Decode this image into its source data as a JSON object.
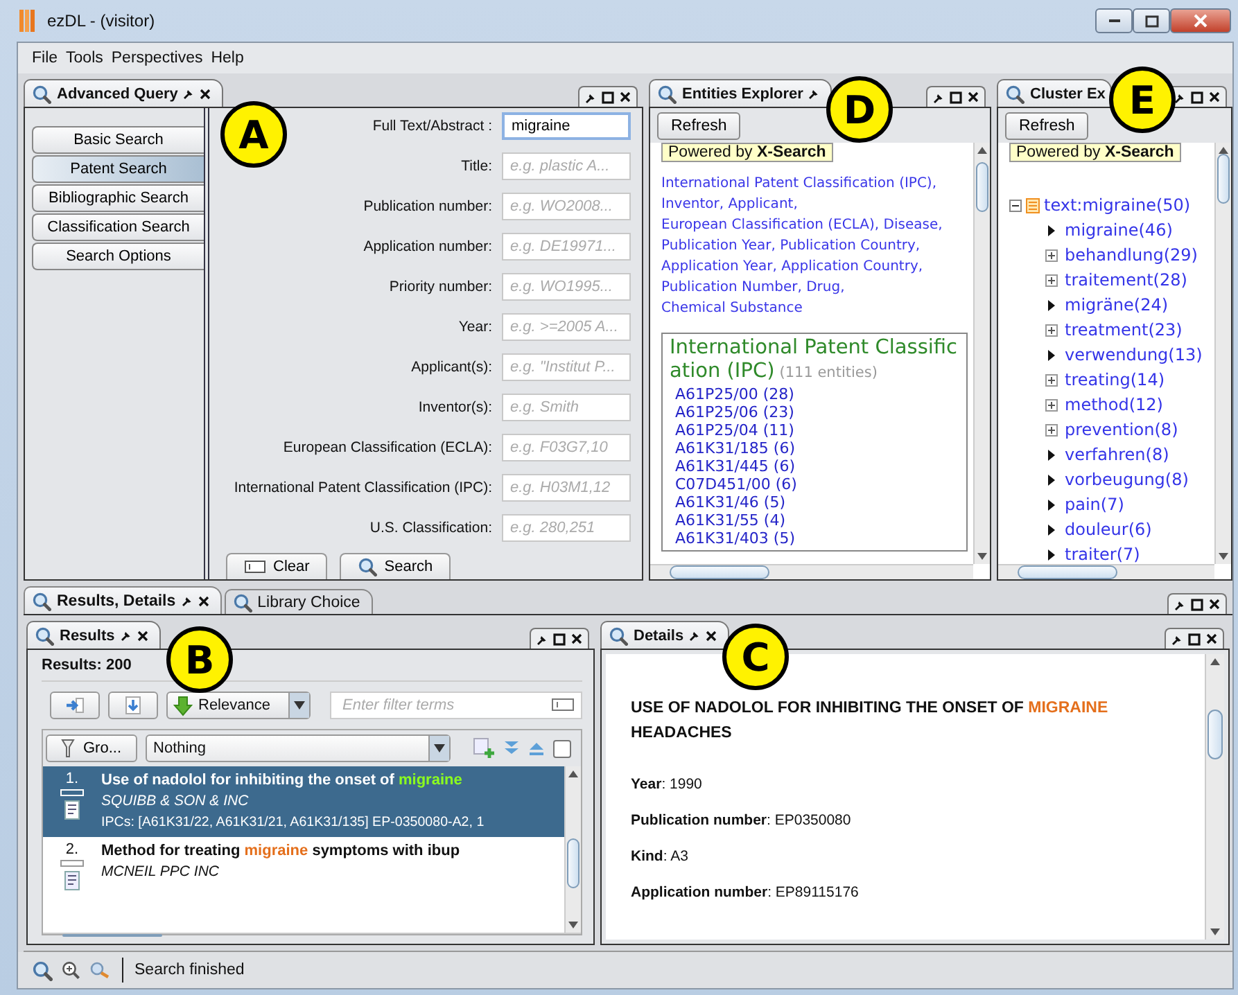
{
  "window": {
    "title": "ezDL - (visitor)"
  },
  "menu": [
    "File",
    "Tools",
    "Perspectives",
    "Help"
  ],
  "advanced_query": {
    "tab": "Advanced Query",
    "modes": [
      {
        "label": "Basic Search",
        "selected": false
      },
      {
        "label": "Patent Search",
        "selected": true
      },
      {
        "label": "Bibliographic Search",
        "selected": false
      },
      {
        "label": "Classification Search",
        "selected": false
      },
      {
        "label": "Search Options",
        "selected": false
      }
    ],
    "fields": [
      {
        "label": "Full Text/Abstract :",
        "value": "migraine"
      },
      {
        "label": "Title:",
        "placeholder": "e.g. plastic A..."
      },
      {
        "label": "Publication number:",
        "placeholder": "e.g. WO2008..."
      },
      {
        "label": "Application number:",
        "placeholder": "e.g. DE19971..."
      },
      {
        "label": "Priority number:",
        "placeholder": "e.g. WO1995..."
      },
      {
        "label": "Year:",
        "placeholder": "e.g. >=2005 A..."
      },
      {
        "label": "Applicant(s):",
        "placeholder": "e.g. \"Institut P..."
      },
      {
        "label": "Inventor(s):",
        "placeholder": "e.g. Smith"
      },
      {
        "label": "European Classification (ECLA):",
        "placeholder": "e.g. F03G7,10"
      },
      {
        "label": "International Patent Classification (IPC):",
        "placeholder": "e.g. H03M1,12"
      },
      {
        "label": "U.S. Classification:",
        "placeholder": "e.g. 280,251"
      }
    ],
    "buttons": [
      {
        "label": "Clear",
        "kind": "clear"
      },
      {
        "label": "Search",
        "kind": "search"
      }
    ]
  },
  "entities_explorer": {
    "tab": "Entities Explorer",
    "refresh": "Refresh",
    "powered_by": "Powered by **X-Search**",
    "entity_types": [
      "International Patent Classification (IPC),",
      "Inventor,",
      "Applicant,",
      "European Classification (ECLA),",
      "Disease,",
      "Publication Year,",
      "Publication Country,",
      "Application Year,",
      "Application Country,",
      "Publication Number,",
      "Drug,",
      "Chemical Substance"
    ],
    "section": {
      "title": "International Patent Classification (IPC)",
      "count": "(111 entities)",
      "entries": [
        "A61P25/00 (28)",
        "A61P25/06 (23)",
        "A61P25/04 (11)",
        "A61K31/185 (6)",
        "A61K31/445 (6)",
        "C07D451/00 (6)",
        "A61K31/46 (5)",
        "A61K31/55 (4)",
        "A61K31/403 (5)"
      ]
    }
  },
  "cluster_explorer": {
    "tab": "Cluster Ex",
    "refresh": "Refresh",
    "powered_by": "Powered by **X-Search**",
    "tree": {
      "label": "text:migraine(50)",
      "expanded": true,
      "children": [
        {
          "label": "migraine(46)",
          "kind": "leaf"
        },
        {
          "label": "behandlung(29)",
          "kind": "group"
        },
        {
          "label": "traitement(28)",
          "kind": "group"
        },
        {
          "label": "migräne(24)",
          "kind": "leaf"
        },
        {
          "label": "treatment(23)",
          "kind": "group"
        },
        {
          "label": "verwendung(13)",
          "kind": "leaf"
        },
        {
          "label": "treating(14)",
          "kind": "group"
        },
        {
          "label": "method(12)",
          "kind": "group"
        },
        {
          "label": "prevention(8)",
          "kind": "group"
        },
        {
          "label": "verfahren(8)",
          "kind": "leaf"
        },
        {
          "label": "vorbeugung(8)",
          "kind": "leaf"
        },
        {
          "label": "pain(7)",
          "kind": "leaf"
        },
        {
          "label": "douleur(6)",
          "kind": "leaf"
        },
        {
          "label": "traiter(7)",
          "kind": "leaf"
        }
      ]
    }
  },
  "bottom_tabs": [
    {
      "label": "Results, Details",
      "selected": true
    },
    {
      "label": "Library Choice",
      "selected": false
    }
  ],
  "results": {
    "tab": "Results",
    "count": "Results: 200",
    "sort": "Relevance",
    "filter_placeholder": "Enter filter terms",
    "group_button": "Gro...",
    "group_by": "Nothing",
    "checkbox": {
      "checked": false
    },
    "items": [
      {
        "number": "1.",
        "selected": true,
        "title": [
          {
            "text": "Use of nadolol for inhibiting the onset of ",
            "highlight": false
          },
          {
            "text": "migraine",
            "highlight": true
          }
        ],
        "applicant": "SQUIBB & SON & INC",
        "ipcs": "IPCs: [A61K31/22, A61K31/21, A61K31/135]  EP-0350080-A2, 1"
      },
      {
        "number": "2.",
        "selected": false,
        "title": [
          {
            "text": "Method for treating ",
            "highlight": false
          },
          {
            "text": "migraine",
            "highlight": true
          },
          {
            "text": " symptoms with ibup",
            "highlight": false
          }
        ],
        "applicant": "MCNEIL PPC INC"
      }
    ]
  },
  "details": {
    "tab": "Details",
    "title": [
      {
        "text": "USE OF NADOLOL FOR INHIBITING THE ONSET OF ",
        "highlight": false
      },
      {
        "text": "MIGRAINE",
        "highlight": true
      },
      {
        "text": " HEADACHES",
        "highlight": false
      }
    ],
    "fields": [
      "**Year**: 1990",
      "**Publication number**: EP0350080",
      "**Kind**: A3",
      "**Application number**: EP89115176"
    ]
  },
  "status_bar": {
    "text": "Search finished"
  },
  "callouts": [
    {
      "letter": "A"
    },
    {
      "letter": "B"
    },
    {
      "letter": "C"
    },
    {
      "letter": "D"
    },
    {
      "letter": "E"
    }
  ]
}
